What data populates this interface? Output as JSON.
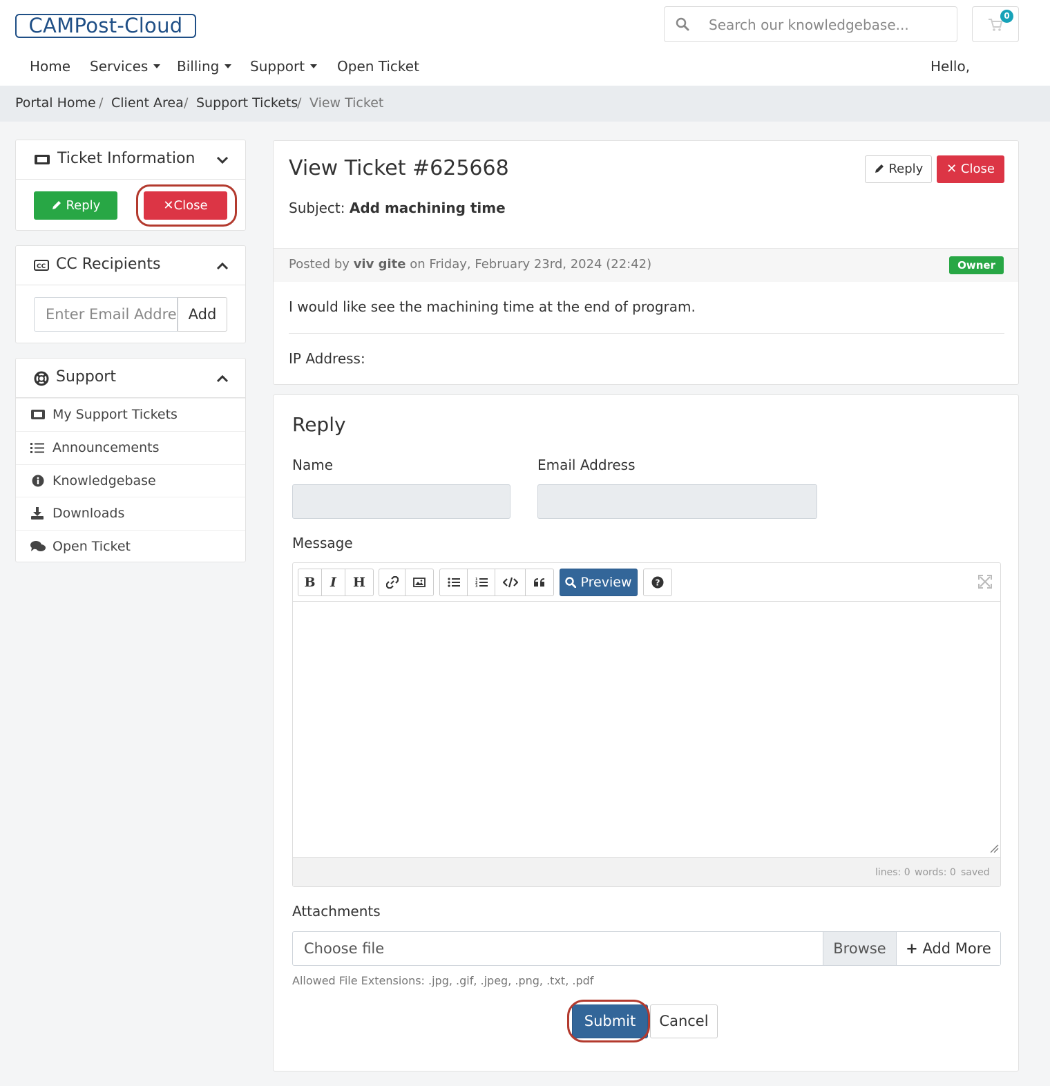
{
  "header": {
    "logo": "CAMPost-Cloud",
    "search_placeholder": "Search our knowledgebase...",
    "cart_count": "0",
    "greeting": "Hello,"
  },
  "nav": {
    "items": [
      {
        "label": "Home",
        "dropdown": false
      },
      {
        "label": "Services",
        "dropdown": true
      },
      {
        "label": "Billing",
        "dropdown": true
      },
      {
        "label": "Support",
        "dropdown": true
      },
      {
        "label": "Open Ticket",
        "dropdown": false
      }
    ]
  },
  "breadcrumb": {
    "items": [
      "Portal Home",
      "Client Area",
      "Support Tickets",
      "View Ticket"
    ],
    "separator": "/"
  },
  "sidebar": {
    "ticket_info": {
      "title": "Ticket Information",
      "reply_label": "Reply",
      "close_label": "Close"
    },
    "cc": {
      "title": "CC Recipients",
      "email_placeholder": "Enter Email Address",
      "add_label": "Add"
    },
    "support": {
      "title": "Support",
      "items": [
        {
          "label": "My Support Tickets",
          "icon": "ticket-icon"
        },
        {
          "label": "Announcements",
          "icon": "list-icon"
        },
        {
          "label": "Knowledgebase",
          "icon": "info-icon"
        },
        {
          "label": "Downloads",
          "icon": "download-icon"
        },
        {
          "label": "Open Ticket",
          "icon": "comments-icon"
        }
      ]
    }
  },
  "ticket": {
    "title": "View Ticket #625668",
    "subject_label": "Subject:",
    "subject": "Add machining time",
    "reply_label": "Reply",
    "close_label": "Close",
    "posted_by_prefix": "Posted by",
    "author": "viv gite",
    "posted_on": "on Friday, February 23rd, 2024 (22:42)",
    "role_badge": "Owner",
    "message": "I would like see the machining time at the end of program.",
    "ip_label": "IP Address:"
  },
  "reply_form": {
    "heading": "Reply",
    "name_label": "Name",
    "email_label": "Email Address",
    "message_label": "Message",
    "preview_label": "Preview",
    "status": {
      "lines": "lines: 0",
      "words": "words: 0",
      "saved": "saved"
    },
    "attachments_label": "Attachments",
    "choose_file": "Choose file",
    "browse_label": "Browse",
    "add_more_label": "Add More",
    "allowed_extensions": "Allowed File Extensions: .jpg, .gif, .jpeg, .png, .txt, .pdf",
    "submit_label": "Submit",
    "cancel_label": "Cancel"
  },
  "colors": {
    "brand": "#1f4f86",
    "success": "#28a745",
    "danger": "#dc3545",
    "primary": "#336699",
    "highlight": "#b33a2e"
  }
}
